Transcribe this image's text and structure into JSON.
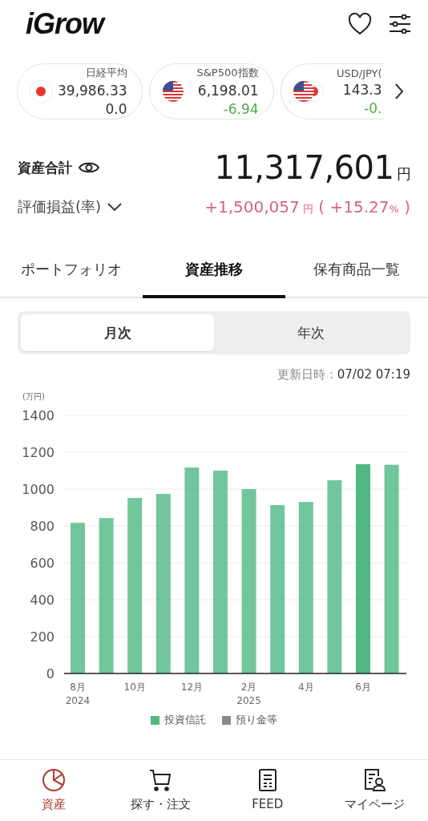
{
  "header": {
    "logo": "iGrow"
  },
  "tickers": [
    {
      "name": "日経平均",
      "kind": "jp",
      "price": "39,986.33",
      "change": "0.0",
      "color": "#333333"
    },
    {
      "name": "S&P500指数",
      "kind": "us",
      "price": "6,198.01",
      "change": "-6.94",
      "color": "#4caa4a"
    },
    {
      "name": "USD/JPY(",
      "kind": "us-jp",
      "price": "143.3",
      "change": "-0.",
      "color": "#4caa4a"
    }
  ],
  "summary": {
    "total_label": "資産合計",
    "total_amount": "11,317,601",
    "total_unit": "円",
    "pnl_label": "評価損益(率)",
    "pnl_amount": "+1,500,057",
    "pnl_unit": "円",
    "pnl_open": "(",
    "pnl_rate": "+15.27",
    "pnl_rate_unit": "%",
    "pnl_close": ")"
  },
  "tabs": [
    {
      "label": "ポートフォリオ",
      "selected": false
    },
    {
      "label": "資産推移",
      "selected": true
    },
    {
      "label": "保有商品一覧",
      "selected": false
    }
  ],
  "period": [
    {
      "label": "月次",
      "selected": true
    },
    {
      "label": "年次",
      "selected": false
    }
  ],
  "updated": {
    "label": "更新日時：",
    "value": "07/02 07:19"
  },
  "chart": {
    "chart_data": {
      "type": "bar",
      "ylabel": "(万円)",
      "categories": [
        "8月\n2024",
        null,
        "10月",
        null,
        "12月",
        null,
        "2月\n2025",
        null,
        "4月",
        null,
        "6月",
        null
      ],
      "series": [
        {
          "name": "投資信託",
          "color": "#4fb883",
          "values": [
            817,
            843,
            952,
            974,
            1117,
            1100,
            1000,
            913,
            930,
            1048,
            1135,
            1132
          ]
        },
        {
          "name": "預り金等",
          "color": "#8a8a8a",
          "values": [
            0,
            0,
            0,
            0,
            0,
            0,
            0,
            0,
            0,
            0,
            0,
            0
          ]
        }
      ],
      "ylim": [
        0,
        1400
      ],
      "yticks": [
        0,
        200,
        400,
        600,
        800,
        1000,
        1200,
        1400
      ],
      "grid": true
    },
    "bars": [
      {
        "selected": false
      },
      {
        "selected": false
      },
      {
        "selected": false
      },
      {
        "selected": false
      },
      {
        "selected": false
      },
      {
        "selected": false
      },
      {
        "selected": false
      },
      {
        "selected": false
      },
      {
        "selected": false
      },
      {
        "selected": false
      },
      {
        "selected": true
      },
      {
        "selected": false
      }
    ]
  },
  "nav": [
    {
      "label": "資産",
      "selected": true
    },
    {
      "label": "探す・注文",
      "selected": false
    },
    {
      "label": "FEED",
      "selected": false
    },
    {
      "label": "マイページ",
      "selected": false
    }
  ]
}
